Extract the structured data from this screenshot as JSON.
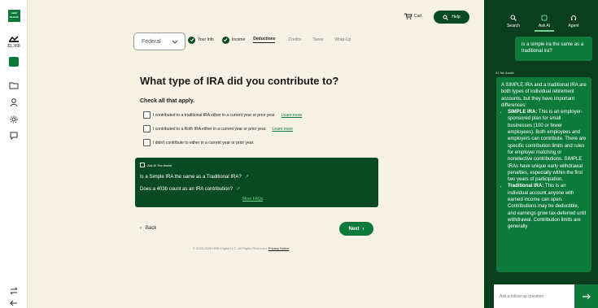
{
  "left_rail": {
    "logo_text": "H&R BLOCK",
    "refund_label": "$1,368",
    "icons": [
      "refund-icon",
      "green-square-icon",
      "folder-icon",
      "person-icon",
      "gear-icon",
      "chat-icon",
      "switch-icon",
      "logout-icon"
    ]
  },
  "header": {
    "cart_label": "Cart",
    "help_label": "Help"
  },
  "return_select": {
    "value": "Federal"
  },
  "steps": [
    {
      "label": "Your Info",
      "state": "complete"
    },
    {
      "label": "Income",
      "state": "complete"
    },
    {
      "label": "Deductions",
      "state": "active"
    },
    {
      "label": "Credits",
      "state": "upcoming"
    },
    {
      "label": "Taxes",
      "state": "upcoming"
    },
    {
      "label": "Wrap-Up",
      "state": "upcoming"
    }
  ],
  "main": {
    "title": "What type of IRA did you contribute to?",
    "subtitle": "Check all that apply.",
    "options": [
      {
        "label": "I contributed to a traditional IRA either in a current year or prior year.",
        "link": "Learn more"
      },
      {
        "label": "I contributed to a Roth IRA either in a current year or prior year.",
        "link": "Learn more"
      },
      {
        "label": "I didn't contribute to either in a current year or prior year.",
        "link": ""
      }
    ]
  },
  "assist_card": {
    "header": "Ask AI Tax Assist",
    "questions": [
      "Is a Simple IRA the same as a Traditional IRA?",
      "Does a 403b count as an IRA contribution?"
    ],
    "more_label": "More FAQs"
  },
  "nav": {
    "back_label": "Back",
    "next_label": "Next"
  },
  "footer": {
    "copyright": "© 2025-2026 HRB Digital LLC. All Rights Reserved.",
    "privacy_label": "Privacy Notice"
  },
  "panel": {
    "tabs": [
      {
        "label": "Search",
        "icon": "search-icon"
      },
      {
        "label": "Ask AI",
        "icon": "ai-icon"
      },
      {
        "label": "Agent",
        "icon": "headset-icon"
      }
    ],
    "active_tab": "Ask AI",
    "user_question": "is a simple ira the same as a traditional ira?",
    "ai_label": "AI Tax Assist",
    "answer_intro": "A SIMPLE IRA and a traditional IRA are both types of individual retirement accounts, but they have important differences:",
    "answer_items": [
      {
        "term": "SIMPLE IRA:",
        "text": " This is an employer-sponsored plan for small businesses (100 or fewer employees). Both employees and employers can contribute. There are specific contribution limits and rules for employer matching or nonelective contributions. SIMPLE IRAs have unique early withdrawal penalties, especially within the first two years of participation."
      },
      {
        "term": "Traditional IRA:",
        "text": " This is an individual account anyone with earned income can open. Contributions may be deductible, and earnings grow tax-deferred until withdrawal. Contribution limits are generally"
      }
    ],
    "input_placeholder": "Ask a follow-up question",
    "send_icon": "arrow-right-icon"
  },
  "colors": {
    "brand_green": "#0d7a3b",
    "dark_green": "#0a4a22",
    "panel_green": "#0b3d1f",
    "background": "#f5f1e4"
  }
}
